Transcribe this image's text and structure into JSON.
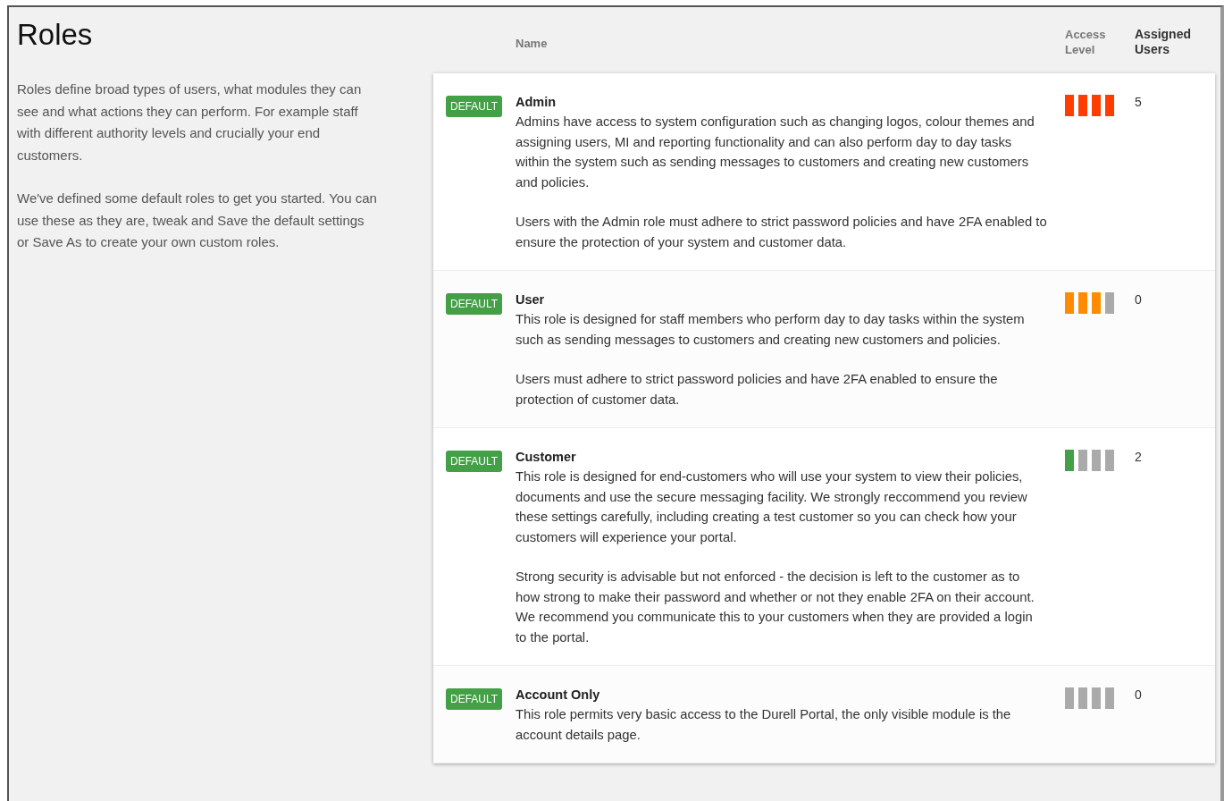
{
  "page": {
    "title": "Roles"
  },
  "intro": [
    "Roles define broad types of users, what modules they can see and what actions they can perform. For example staff with different authority levels and crucially your end customers.",
    "We've defined some default roles to get you started. You can use these as they are, tweak and Save the default settings or Save As to create your own custom roles."
  ],
  "table": {
    "columns": [
      "Name",
      "Access Level",
      "Assigned Users"
    ],
    "rows": [
      {
        "badge": "DEFAULT",
        "name": "Admin",
        "description": [
          "Admins have access to system configuration such as changing logos, colour themes and assigning users, MI and reporting functionality and can also perform day to day tasks within the system such as sending messages to customers and creating new customers and policies.",
          "Users with the Admin role must adhere to strict password policies and have 2FA enabled to ensure the protection of your system and customer data."
        ],
        "access_level": [
          {
            "on": true
          },
          {
            "on": true
          },
          {
            "on": true
          },
          {
            "on": true
          }
        ],
        "color": "#ff3d00",
        "assigned_users": "5"
      },
      {
        "badge": "DEFAULT",
        "name": "User",
        "description": [
          "This role is designed for staff members who perform day to day tasks within the system such as sending messages to customers and creating new customers and policies.",
          "Users must adhere to strict password policies and have 2FA enabled to ensure the protection of customer data."
        ],
        "access_level": [
          {
            "on": true
          },
          {
            "on": true
          },
          {
            "on": true
          },
          {
            "on": false
          }
        ],
        "color": "#ff8c00",
        "assigned_users": "0"
      },
      {
        "badge": "DEFAULT",
        "name": "Customer",
        "description": [
          "This role is designed for end-customers who will use your system to view their policies, documents and use the secure messaging facility. We strongly reccommend you review these settings carefully, including creating a test customer so you can check how your customers will experience your portal.",
          "Strong security is advisable but not enforced - the decision is left to the customer as to how strong to make their password and whether or not they enable 2FA on their account. We recommend you communicate this to your customers when they are provided a login to the portal."
        ],
        "access_level": [
          {
            "on": true
          },
          {
            "on": false
          },
          {
            "on": false
          },
          {
            "on": false
          }
        ],
        "color": "#43a047",
        "assigned_users": "2"
      },
      {
        "badge": "DEFAULT",
        "name": "Account Only",
        "description": [
          "This role permits very basic access to the Durell Portal, the only visible module is the account details page."
        ],
        "access_level": [
          {
            "on": false
          },
          {
            "on": false
          },
          {
            "on": false
          },
          {
            "on": false
          }
        ],
        "assigned_users": "0"
      }
    ]
  }
}
